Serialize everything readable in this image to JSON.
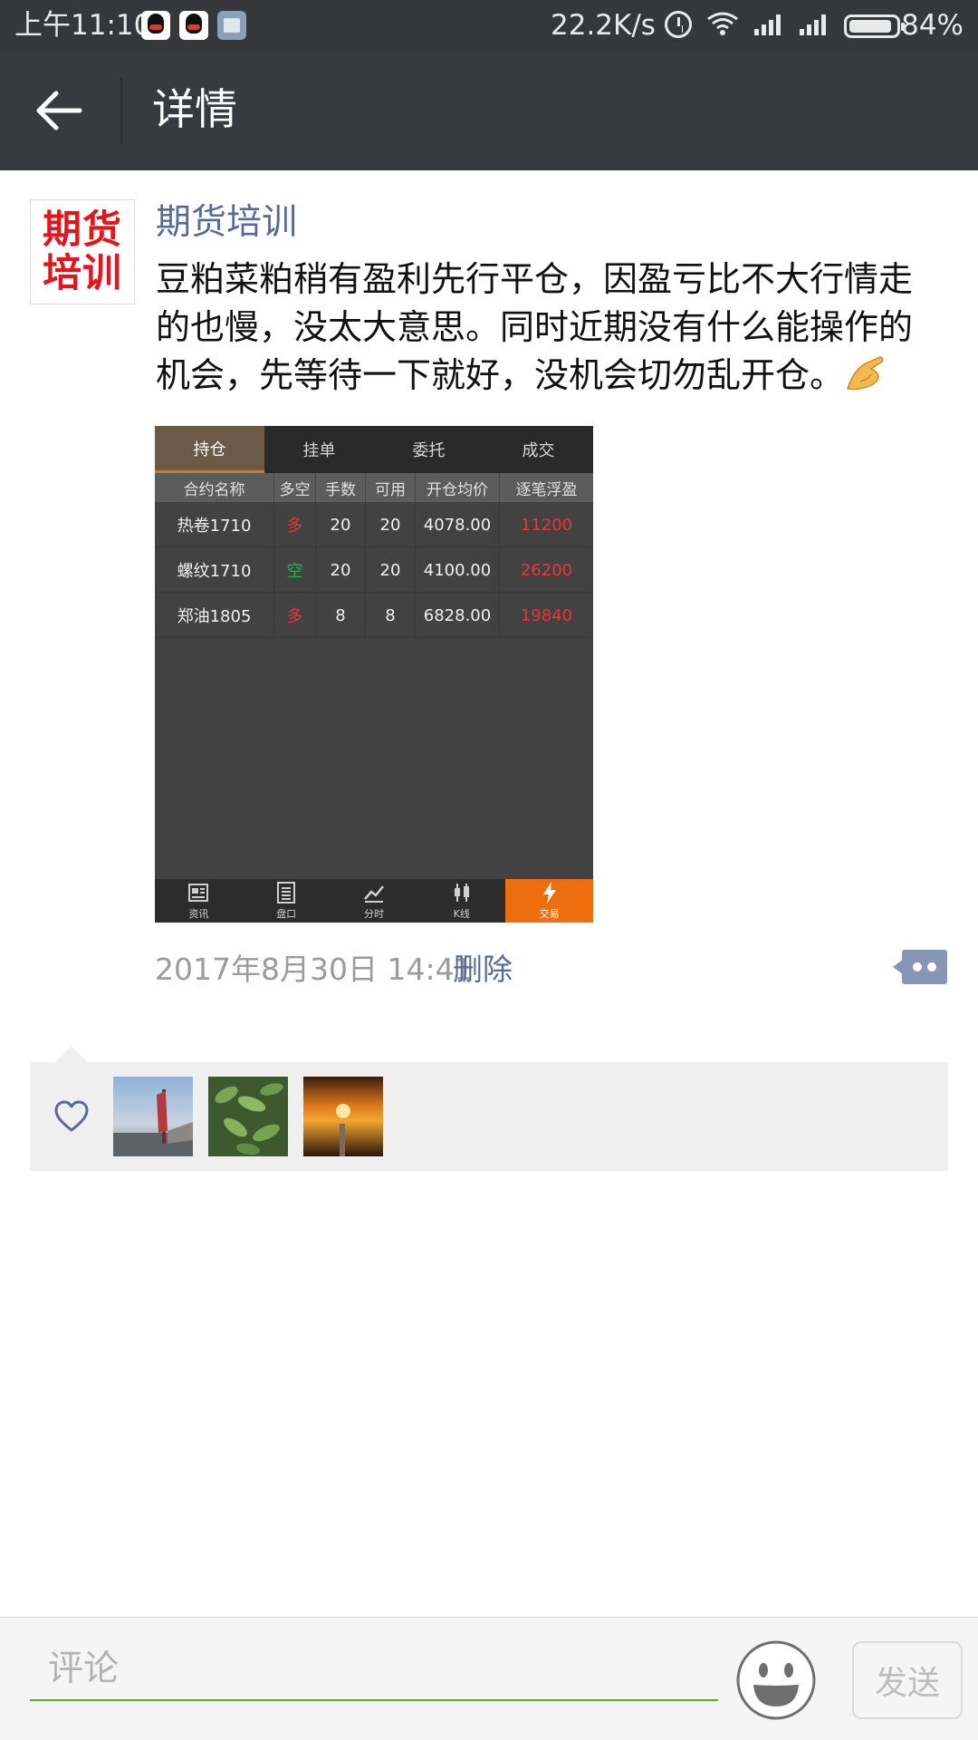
{
  "status_bar": {
    "time": "上午11:10",
    "network_speed": "22.2K/s",
    "battery_percent": "84%",
    "battery_level": 0.84,
    "icons": [
      "qq-icon",
      "qq-icon",
      "message-icon",
      "alarm-icon",
      "wifi-icon",
      "signal-icon",
      "signal-icon",
      "battery-icon"
    ]
  },
  "header": {
    "back_icon": "arrow-left-icon",
    "title": "详情"
  },
  "post": {
    "avatar_text": [
      "期货",
      "培训"
    ],
    "author": "期货培训",
    "text": "豆粕菜粕稍有盈利先行平仓，因盈亏比不大行情走的也慢，没太大意思。同时近期没有什么能操作的机会，先等待一下就好，没机会切勿乱开仓。",
    "emoji": "pointing-hand-emoji",
    "timestamp": "2017年8月30日 14:41",
    "delete_label": "删除",
    "more_icon": "comment-menu-icon"
  },
  "attached_screenshot": {
    "tabs": [
      "持仓",
      "挂单",
      "委托",
      "成交"
    ],
    "active_tab": 0,
    "columns": [
      "合约名称",
      "多空",
      "手数",
      "可用",
      "开仓均价",
      "逐笔浮盈"
    ],
    "rows": [
      [
        "热卷1710",
        "多",
        "20",
        "20",
        "4078.00",
        "11200"
      ],
      [
        "螺纹1710",
        "空",
        "20",
        "20",
        "4100.00",
        "26200"
      ],
      [
        "郑油1805",
        "多",
        "8",
        "8",
        "6828.00",
        "19840"
      ]
    ],
    "bottom_nav": [
      {
        "label": "资讯",
        "icon": "news-icon"
      },
      {
        "label": "盘口",
        "icon": "orderbook-icon"
      },
      {
        "label": "分时",
        "icon": "line-chart-icon"
      },
      {
        "label": "K线",
        "icon": "candlestick-icon"
      },
      {
        "label": "交易",
        "icon": "lightning-icon"
      }
    ],
    "colors": {
      "long": "#e8353a",
      "short": "#21b24b",
      "profit": "#e8353a",
      "active_nav": "#ee6d0f"
    }
  },
  "likes": {
    "icon": "heart-icon",
    "avatars": [
      "avatar-dusk-pier",
      "avatar-green-leaves",
      "avatar-sunset-sea"
    ]
  },
  "comment_bar": {
    "placeholder": "评论",
    "emoji_icon": "smiley-icon",
    "send_label": "发送"
  },
  "colors": {
    "title_bar": "#393a3f",
    "status_bar": "#35373a",
    "link": "#576b95",
    "input_underline": "#45c01a",
    "avatar_text": "#e3161d"
  }
}
